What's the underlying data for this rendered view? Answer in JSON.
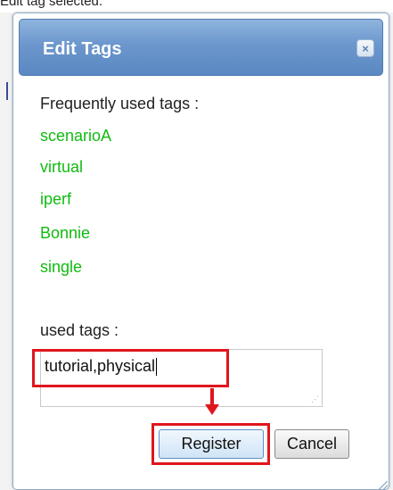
{
  "background": {
    "top_text": "Edit tag selected."
  },
  "dialog": {
    "title": "Edit Tags",
    "close_label": "×",
    "frequent_label": "Frequently used tags :",
    "frequent_tags": [
      "scenarioA",
      "virtual",
      "iperf",
      "Bonnie",
      "single"
    ],
    "used_label": "used tags :",
    "used_value": "tutorial,physical",
    "buttons": {
      "register": "Register",
      "cancel": "Cancel"
    }
  },
  "colors": {
    "title_bar": "#6c97cd",
    "tag_green": "#11bb11",
    "highlight_red": "#e0161c"
  },
  "icons": {
    "close": "close-icon",
    "arrow": "down-arrow-annotation",
    "resize": "resize-grip-icon"
  }
}
